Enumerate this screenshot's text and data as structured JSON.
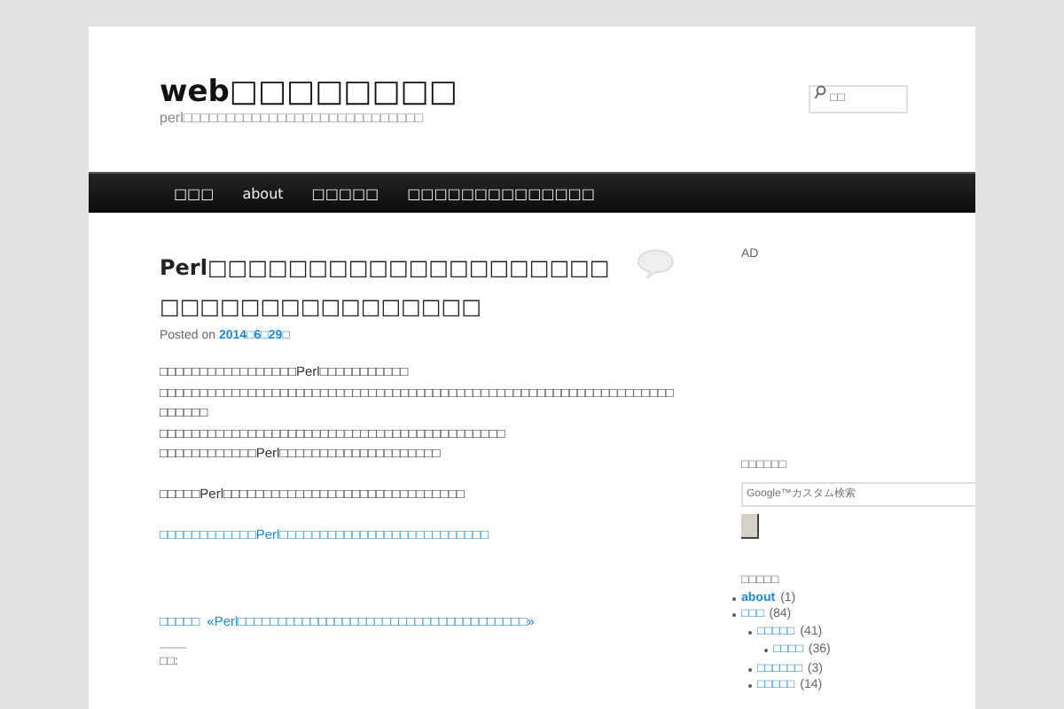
{
  "site": {
    "title": "web□□□□□□□□",
    "tagline": "perl□□□□□□□□□□□□□□□□□□□□□□□□□□□□",
    "search_placeholder": "□□"
  },
  "nav": [
    {
      "label": "□□□"
    },
    {
      "label": "about"
    },
    {
      "label": "□□□□□"
    },
    {
      "label": "□□□□□□□□□□□□□□"
    }
  ],
  "post": {
    "title": "Perl□□□□□□□□□□□□□□□□□□□□□□□□□□□□□□□□□□□□",
    "posted_prefix": "Posted on",
    "date": "2014□6□29□",
    "paragraphs": [
      [
        "□□□□□□□□□□□□□□□□□Perl□□□□□□□□□□□",
        "□□□□□□□□□□□□□□□□□□□□□□□□□□□□□□□□□□□□□□□□□□□□□□□□□□□□□□□□□□□□□□□□□□□□□□",
        "□□□□□□□□□□□□□□□□□□□□□□□□□□□□□□□□□□□□□□□□□□□",
        "□□□□□□□□□□□□Perl□□□□□□□□□□□□□□□□□□□□"
      ],
      [
        "□□□□□Perl□□□□□□□□□□□□□□□□□□□□□□□□□□□□□□"
      ]
    ],
    "link": "□□□□□□□□□□□□Perl□□□□□□□□□□□□□□□□□□□□□□□□□□",
    "nav_label": "□□□□□",
    "nav_link": "«Perl□□□□□□□□□□□□□□□□□□□□□□□□□□□□□□□□□□□□»",
    "footer_label": "□□:"
  },
  "sidebar": {
    "ad_label": "AD",
    "search_title": "□□□□□□",
    "search_placeholder": "Google™カスタム検索",
    "categories_title": "□□□□□",
    "categories": [
      {
        "name": "about",
        "count": "(1)"
      },
      {
        "name": "□□□",
        "count": "(84)",
        "children": [
          {
            "name": "□□□□□",
            "count": "(41)",
            "children": [
              {
                "name": "□□□□",
                "count": "(36)"
              }
            ]
          },
          {
            "name": "□□□□□□",
            "count": "(3)"
          },
          {
            "name": "□□□□□",
            "count": "(14)"
          }
        ]
      }
    ]
  }
}
